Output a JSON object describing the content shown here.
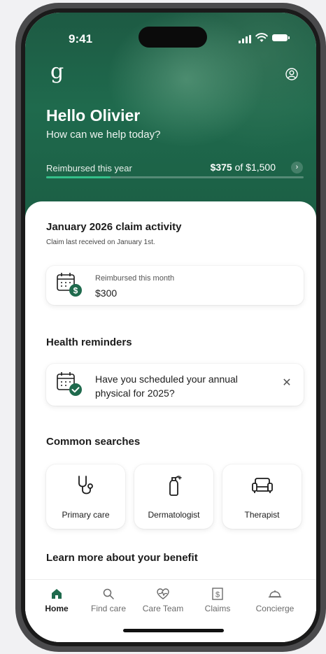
{
  "status": {
    "time": "9:41"
  },
  "header": {
    "logo": "g",
    "greeting": "Hello Olivier",
    "subtitle": "How can we help today?",
    "reimbursed_label": "Reimbursed this year",
    "reimbursed_amount": "$375",
    "reimbursed_of": "of $1,500",
    "reimbursed_fraction": 0.25,
    "accent_color": "#1f6a4d",
    "progress_color": "#35c08a"
  },
  "claims": {
    "title": "January 2026 claim activity",
    "subtitle": "Claim last received on January 1st.",
    "card_label": "Reimbursed this month",
    "card_value": "$300"
  },
  "reminders": {
    "title": "Health reminders",
    "text": "Have you scheduled your annual physical for 2025?"
  },
  "searches": {
    "title": "Common searches",
    "items": [
      {
        "label": "Primary care",
        "icon": "stethoscope-icon"
      },
      {
        "label": "Dermatologist",
        "icon": "lotion-bottle-icon"
      },
      {
        "label": "Therapist",
        "icon": "couch-icon"
      }
    ]
  },
  "learn": {
    "title": "Learn more about your benefit"
  },
  "tabbar": {
    "items": [
      {
        "label": "Home",
        "icon": "home-icon",
        "active": true
      },
      {
        "label": "Find care",
        "icon": "search-icon",
        "active": false
      },
      {
        "label": "Care Team",
        "icon": "heart-pulse-icon",
        "active": false
      },
      {
        "label": "Claims",
        "icon": "dollar-receipt-icon",
        "active": false
      },
      {
        "label": "Concierge",
        "icon": "service-bell-icon",
        "active": false
      }
    ]
  }
}
